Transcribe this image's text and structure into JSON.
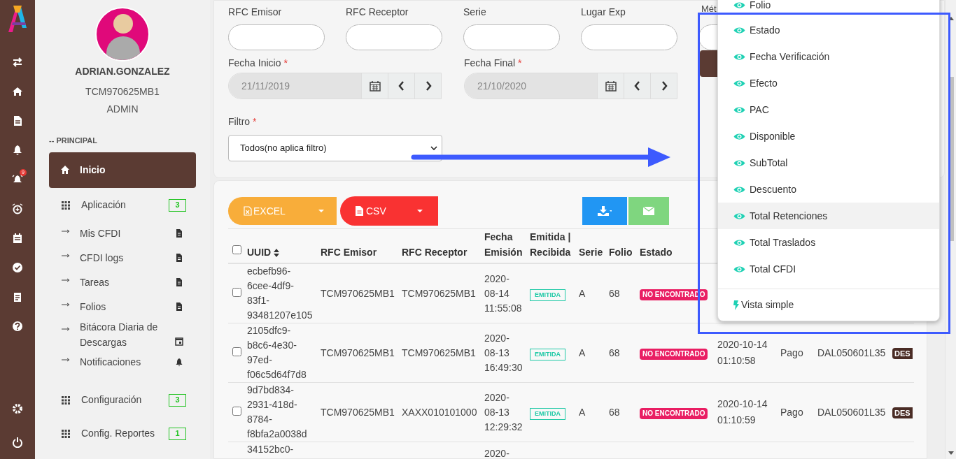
{
  "rail": {
    "alert_badge": "9"
  },
  "profile": {
    "username": "ADRIAN.GONZALEZ",
    "rfc": "TCM970625MB1",
    "role": "ADMIN"
  },
  "sidebar": {
    "section": "-- PRINCIPAL",
    "items": [
      {
        "kind": "main",
        "label": "Inicio",
        "selected": true
      },
      {
        "kind": "group",
        "label": "Aplicación",
        "badge": "3",
        "selected": false
      },
      {
        "kind": "sub",
        "label": "Mis CFDI",
        "selected": false
      },
      {
        "kind": "sub",
        "label": "CFDI logs",
        "selected": false
      },
      {
        "kind": "sub",
        "label": "Tareas",
        "selected": false
      },
      {
        "kind": "sub",
        "label": "Folios",
        "selected": false
      },
      {
        "kind": "sub",
        "label": "Bitácora Diaria de Descargas",
        "selected": false
      },
      {
        "kind": "sub",
        "label": "Notificaciones",
        "selected": false
      },
      {
        "kind": "group",
        "label": "Configuración",
        "badge": "3",
        "selected": false
      },
      {
        "kind": "group",
        "label": "Config. Reportes",
        "badge": "1",
        "selected": false
      }
    ]
  },
  "filters": {
    "text_fields": [
      {
        "label": "RFC Emisor"
      },
      {
        "label": "RFC Receptor"
      },
      {
        "label": "Serie"
      },
      {
        "label": "Lugar Exp"
      },
      {
        "label": "Mét"
      }
    ],
    "dates": [
      {
        "label": "Fecha Inicio",
        "required_mark": "*",
        "value": "21/11/2019"
      },
      {
        "label": "Fecha Final",
        "required_mark": "*",
        "value": "21/10/2020"
      }
    ],
    "filter": {
      "label": "Filtro",
      "required_mark": "*",
      "value": "Todos(no aplica filtro)"
    }
  },
  "toolbar": {
    "buttons": [
      {
        "kind": "excel",
        "label": "EXCEL"
      },
      {
        "kind": "csv",
        "label": "CSV"
      },
      {
        "kind": "download"
      },
      {
        "kind": "email"
      }
    ]
  },
  "table": {
    "select_all_checked": false,
    "columns": [
      "UUID",
      "RFC Emisor",
      "RFC Receptor",
      "Fecha Emisión",
      "Emitida | Recibida",
      "Serie",
      "Folio",
      "Estado"
    ],
    "rows": [
      {
        "checked": false,
        "uuid": "ecbefb96-6cee-4df9-83f1-93481207e105",
        "rfc_emisor": "TCM970625MB1",
        "rfc_receptor": "TCM970625MB1",
        "fecha_emision": "2020-08-14 11:55:08",
        "tipo": "EMITIDA",
        "serie": "A",
        "folio": "68",
        "estado": "NO ENCONTRADO"
      },
      {
        "checked": false,
        "uuid": "2105dfc9-b8c6-4e30-97ed-f06c5d64f7d8",
        "rfc_emisor": "TCM970625MB1",
        "rfc_receptor": "TCM970625MB1",
        "fecha_emision": "2020-08-13 16:49:30",
        "tipo": "EMITIDA",
        "serie": "A",
        "folio": "68",
        "estado": "NO ENCONTRADO",
        "fecha_verificacion": "2020-10-14 01:10:58",
        "efecto": "Pago",
        "pac": "DAL050601L35",
        "disponible": "DES"
      },
      {
        "checked": false,
        "uuid": "9d7bd834-2931-418d-8784-f8bfa2a0038d",
        "rfc_emisor": "TCM970625MB1",
        "rfc_receptor": "XAXX010101000",
        "fecha_emision": "2020-08-13 12:29:32",
        "tipo": "EMITIDA",
        "serie": "A",
        "folio": "68",
        "estado": "NO ENCONTRADO",
        "fecha_verificacion": "2020-10-14 01:10:59",
        "efecto": "Pago",
        "pac": "DAL050601L35",
        "disponible": "DES"
      },
      {
        "uuid": "34152bc0-",
        "fecha_emision": "2020-"
      }
    ]
  },
  "column_menu": {
    "items": [
      {
        "label": "Folio",
        "highlighted": false
      },
      {
        "label": "Estado",
        "highlighted": false
      },
      {
        "label": "Fecha Verificación",
        "highlighted": false
      },
      {
        "label": "Efecto",
        "highlighted": false
      },
      {
        "label": "PAC",
        "highlighted": false
      },
      {
        "label": "Disponible",
        "highlighted": false
      },
      {
        "label": "SubTotal",
        "highlighted": false
      },
      {
        "label": "Descuento",
        "highlighted": false
      },
      {
        "label": "Total Retenciones",
        "highlighted": true
      },
      {
        "label": "Total Traslados",
        "highlighted": false
      },
      {
        "label": "Total CFDI",
        "highlighted": false
      }
    ],
    "footer": "Vista simple"
  }
}
